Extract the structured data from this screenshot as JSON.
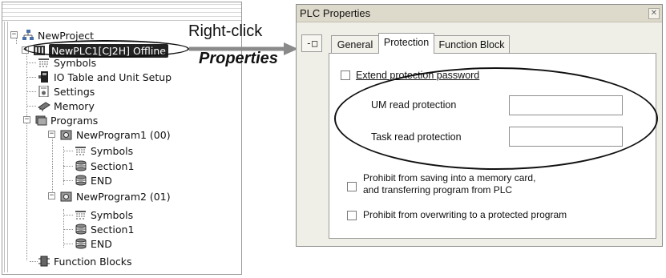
{
  "tree": {
    "project_label": "NewProject",
    "plc_label": "NewPLC1[CJ2H] Offline",
    "items": {
      "symbols": "Symbols",
      "io_table": "IO Table and Unit Setup",
      "settings": "Settings",
      "memory": "Memory",
      "programs": "Programs",
      "program1": "NewProgram1 (00)",
      "program1_symbols": "Symbols",
      "program1_section": "Section1",
      "program1_end": "END",
      "program2": "NewProgram2 (01)",
      "program2_symbols": "Symbols",
      "program2_section": "Section1",
      "program2_end": "END",
      "function_blocks": "Function Blocks"
    }
  },
  "callout": {
    "action": "Right-click",
    "target": "Properties"
  },
  "dialog": {
    "title": "PLC Properties",
    "close_glyph": "✕",
    "pin_glyph": "-□",
    "tabs": [
      "General",
      "Protection",
      "Function Block"
    ],
    "active_tab": "Protection",
    "extend_password_label": "Extend protection password",
    "um_read_label": "UM read protection",
    "um_read_value": "",
    "task_read_label": "Task read protection",
    "task_read_value": "",
    "prohibit_saving_line1": "Prohibit from saving into a memory card,",
    "prohibit_saving_line2": "and transferring program from PLC",
    "prohibit_overwrite_label": "Prohibit from overwriting to a protected program",
    "checks": {
      "extend_password": false,
      "prohibit_saving": false,
      "prohibit_overwrite": false
    }
  }
}
